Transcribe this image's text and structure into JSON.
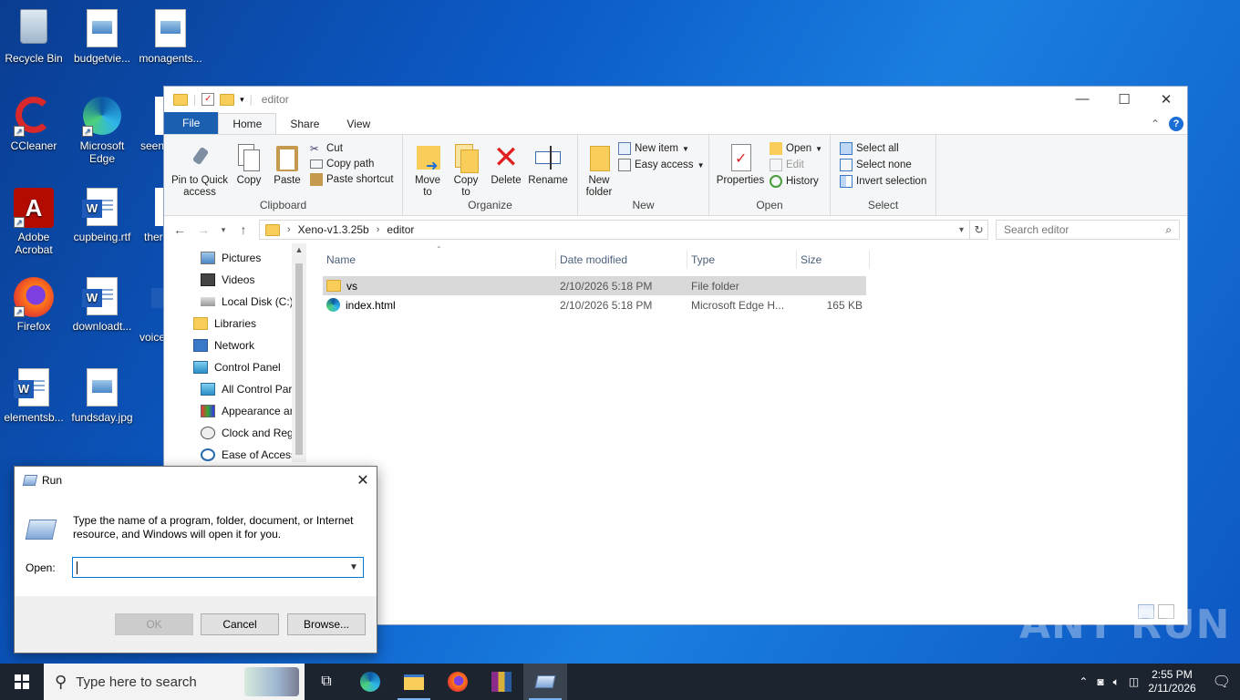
{
  "desktop": {
    "icons": [
      {
        "label": "Recycle Bin"
      },
      {
        "label": "budgetvie..."
      },
      {
        "label": "monagents..."
      },
      {
        "label": "CCleaner"
      },
      {
        "label": "Microsoft Edge"
      },
      {
        "label": "seen"
      },
      {
        "label": "Adobe Acrobat"
      },
      {
        "label": "cupbeing.rtf"
      },
      {
        "label": "ther"
      },
      {
        "label": "Firefox"
      },
      {
        "label": "downloadt..."
      },
      {
        "label": "voice"
      },
      {
        "label": "elementsb..."
      },
      {
        "label": "fundsday.jpg"
      }
    ]
  },
  "explorer": {
    "title": "editor",
    "tabs": {
      "file": "File",
      "home": "Home",
      "share": "Share",
      "view": "View"
    },
    "ribbon": {
      "clipboard": {
        "name": "Clipboard",
        "pin": "Pin to Quick access",
        "copy": "Copy",
        "paste": "Paste",
        "cut": "Cut",
        "copy_path": "Copy path",
        "paste_shortcut": "Paste shortcut"
      },
      "organize": {
        "name": "Organize",
        "move_to": "Move to",
        "copy_to": "Copy to",
        "delete": "Delete",
        "rename": "Rename"
      },
      "new": {
        "name": "New",
        "new_folder": "New folder",
        "new_item": "New item",
        "easy_access": "Easy access"
      },
      "open": {
        "name": "Open",
        "properties": "Properties",
        "open": "Open",
        "edit": "Edit",
        "history": "History"
      },
      "select": {
        "name": "Select",
        "select_all": "Select all",
        "select_none": "Select none",
        "invert": "Invert selection"
      }
    },
    "address": {
      "crumbs": [
        "Xeno-v1.3.25b",
        "editor"
      ]
    },
    "search": {
      "placeholder": "Search editor"
    },
    "nav": [
      {
        "label": "Pictures"
      },
      {
        "label": "Videos"
      },
      {
        "label": "Local Disk (C:)"
      },
      {
        "label": "Libraries"
      },
      {
        "label": "Network"
      },
      {
        "label": "Control Panel"
      },
      {
        "label": "All Control Par"
      },
      {
        "label": "Appearance an"
      },
      {
        "label": "Clock and Regi"
      },
      {
        "label": "Ease of Access"
      }
    ],
    "columns": {
      "name": "Name",
      "date": "Date modified",
      "type": "Type",
      "size": "Size"
    },
    "files": [
      {
        "name": "vs",
        "date": "2/10/2026 5:18 PM",
        "type": "File folder",
        "size": ""
      },
      {
        "name": "index.html",
        "date": "2/10/2026 5:18 PM",
        "type": "Microsoft Edge H...",
        "size": "165 KB"
      }
    ]
  },
  "run": {
    "title": "Run",
    "description": "Type the name of a program, folder, document, or Internet resource, and Windows will open it for you.",
    "open_label": "Open:",
    "value": "",
    "ok": "OK",
    "cancel": "Cancel",
    "browse": "Browse..."
  },
  "taskbar": {
    "search_placeholder": "Type here to search",
    "time": "2:55 PM",
    "date": "2/11/2026"
  },
  "watermark": "ANY RUN"
}
